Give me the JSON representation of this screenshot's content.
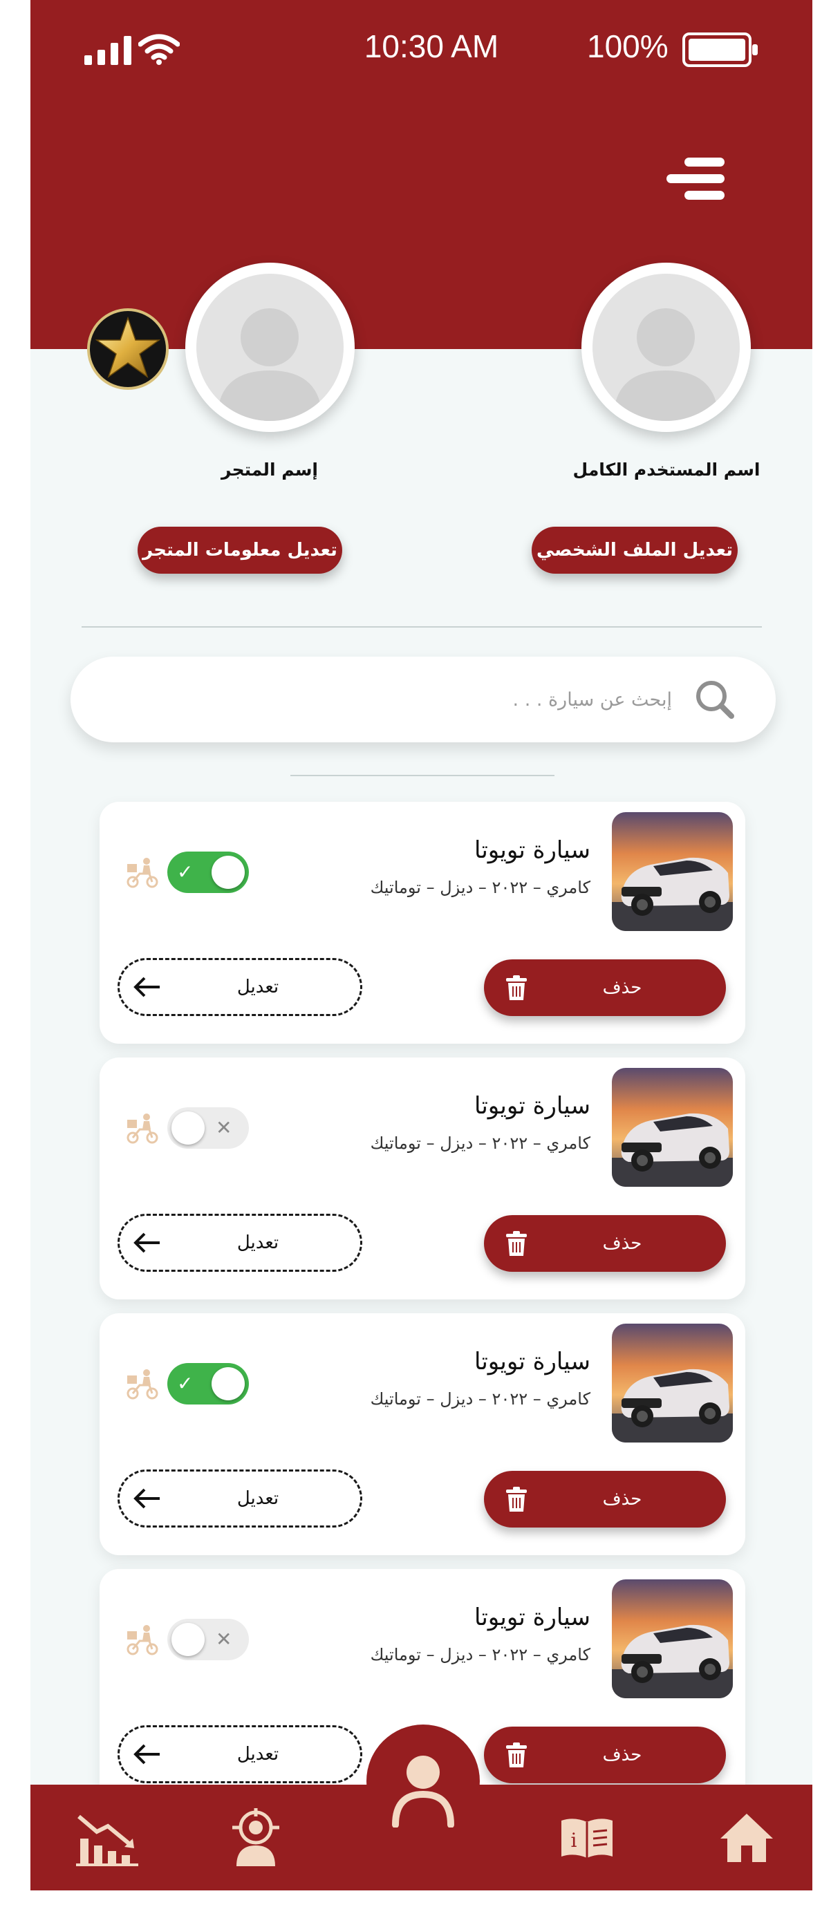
{
  "status_bar": {
    "time": "10:30 AM",
    "battery": "100%"
  },
  "profile": {
    "user_name": "اسم المستخدم الكامل",
    "store_name": "إسم المتجر",
    "edit_profile_label": "تعديل الملف الشخصي",
    "edit_store_label": "تعديل معلومات المتجر"
  },
  "search": {
    "placeholder": "إبحث عن سيارة . . ."
  },
  "cars": [
    {
      "title": "سيارة تويوتا",
      "subtitle": "كامري – ٢٠٢٢ – ديزل – توماتيك",
      "active": true,
      "toggle_mark": "✓",
      "delete_label": "حذف",
      "edit_label": "تعديل"
    },
    {
      "title": "سيارة تويوتا",
      "subtitle": "كامري – ٢٠٢٢ – ديزل – توماتيك",
      "active": false,
      "toggle_mark": "✕",
      "delete_label": "حذف",
      "edit_label": "تعديل"
    },
    {
      "title": "سيارة تويوتا",
      "subtitle": "كامري – ٢٠٢٢ – ديزل – توماتيك",
      "active": true,
      "toggle_mark": "✓",
      "delete_label": "حذف",
      "edit_label": "تعديل"
    },
    {
      "title": "سيارة تويوتا",
      "subtitle": "كامري – ٢٠٢٢ – ديزل – توماتيك",
      "active": false,
      "toggle_mark": "✕",
      "delete_label": "حذف",
      "edit_label": "تعديل"
    }
  ],
  "bottom_nav": [
    "chart-down-icon",
    "agent-target-icon",
    "profile-icon",
    "book-info-icon",
    "home-icon"
  ],
  "colors": {
    "brand": "#961e20",
    "background": "#f3f8f8",
    "toggle_on": "#3fb34a",
    "nav_icon": "#f3d9c4"
  }
}
